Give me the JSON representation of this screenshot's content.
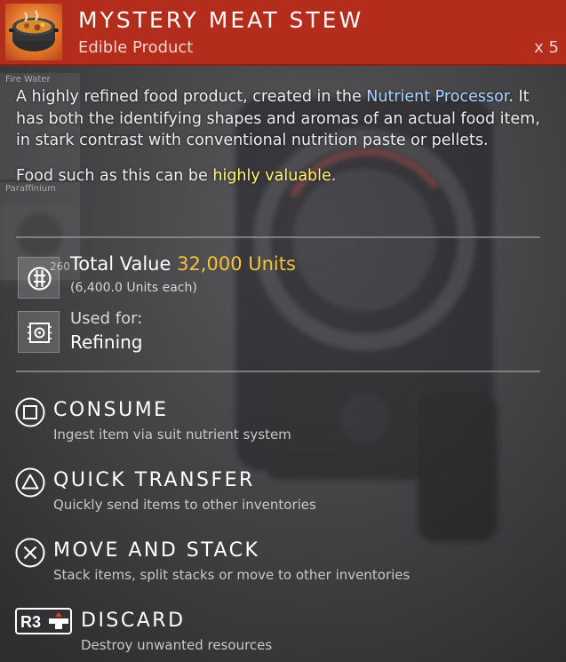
{
  "colors": {
    "header_bg": "#b42d1c",
    "value_highlight": "#f4c33a",
    "link_highlight": "#a8d4ff",
    "valuable_highlight": "#fff36e"
  },
  "background": {
    "slot_1_label": "Fire Water",
    "slot_2_label": "Paraffinium",
    "slot_3_count": "260"
  },
  "header": {
    "icon": "stew-pot-icon",
    "title": "MYSTERY MEAT STEW",
    "subtitle": "Edible Product",
    "quantity": "x 5"
  },
  "description": {
    "part1": "A highly refined food product, created in the ",
    "link": "Nutrient Processor",
    "part2": ". It has both the identifying shapes and aromas of an actual food item, in stark contrast with conventional nutrition paste or pellets.",
    "line2_prefix": "Food such as this can be ",
    "line2_highlight": "highly valuable",
    "line2_suffix": "."
  },
  "stats": {
    "value_icon": "units-icon",
    "value_label": "Total Value ",
    "value_amount": "32,000 Units",
    "value_each": "(6,400.0 Units each)",
    "used_icon": "refiner-icon",
    "used_label": "Used for:",
    "used_value": "Refining"
  },
  "actions": [
    {
      "icon": "square-button-icon",
      "title": "CONSUME",
      "desc": "Ingest item via suit nutrient system"
    },
    {
      "icon": "triangle-button-icon",
      "title": "QUICK TRANSFER",
      "desc": "Quickly send items to other inventories"
    },
    {
      "icon": "cross-button-icon",
      "title": "MOVE AND STACK",
      "desc": "Stack items, split stacks or move to other inventories"
    },
    {
      "icon": "r3-button-icon",
      "title": "DISCARD",
      "desc": "Destroy unwanted resources"
    }
  ]
}
